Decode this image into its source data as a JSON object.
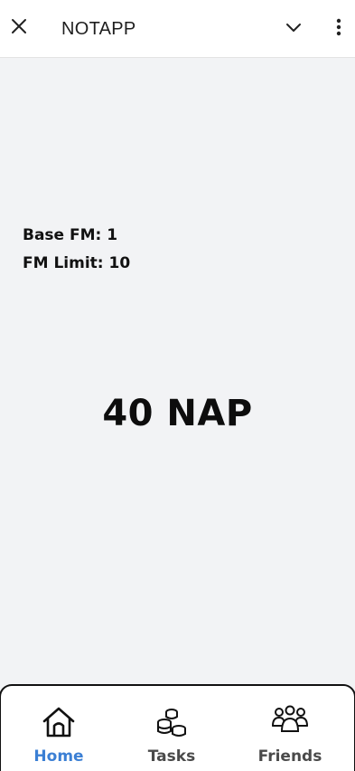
{
  "header": {
    "title": "NOTAPP",
    "close_icon": "close-icon",
    "chevron_icon": "chevron-down-icon",
    "menu_icon": "more-vertical-icon"
  },
  "main": {
    "base_fm": "Base FM: 1",
    "fm_limit": "FM Limit: 10",
    "balance": "40 NAP"
  },
  "nav": {
    "items": [
      {
        "label": "Home",
        "icon": "home-icon",
        "active": true
      },
      {
        "label": "Tasks",
        "icon": "coins-icon",
        "active": false
      },
      {
        "label": "Friends",
        "icon": "friends-icon",
        "active": false
      }
    ],
    "active_color": "#3b7fd4",
    "inactive_color": "#4a4a4a"
  }
}
